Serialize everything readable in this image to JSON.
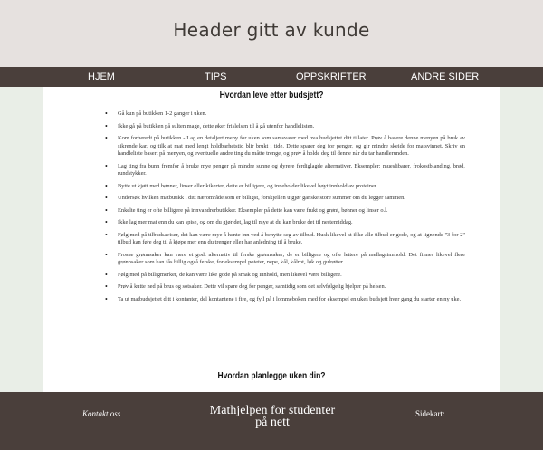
{
  "header": {
    "title": "Header gitt av kunde"
  },
  "nav": {
    "items": [
      "HJEM",
      "TIPS",
      "OPPSKRIFTER",
      "ANDRE SIDER"
    ]
  },
  "document": {
    "title": "Hvordan leve etter budsjett?",
    "subtitle": "Hvordan planlegge uken din?",
    "tips": [
      "Gå kun på butikken 1-2 ganger i uken.",
      "Ikke gå på butikken på sulten mage, dette øker frislelsen til å gå utenfor handlelisten.",
      "Kom forberedt på butikken - Lag en detaljert meny for uken som samsvarer med hva budsjettet ditt tillater. Prøv å basere denne menyen på bruk av sikrende kar, og tilk at mat med lengt holdbarhetstid blir brukt i tide. Dette sparer deg for penger, og gir mindre skeide for matsvinnet. Skriv en handleliste basert på menyen, og eventuelle andre ting du måtte trenge, og prøv å holde deg til denne når du tar handlerunden.",
      "Lag ting fra bunn fremfor å bruke mye penger på mindre sunne og dyrere ferdiglagde alternativer. Eksempler: mueslibarer, frokostblanding, brød, rundstykker.",
      "Bytte ut kjøtt med bønner, linser eller kikerter, dette er billigere, og inneholder likevel høyt innhold av proteiner.",
      "Undersøk hvilken matbutikk i ditt nærområde som er billigst, forskjellen utgjør ganske store summer om du legger sammen.",
      "Enkelte ting er ofte billigere på innvandrerbutikker. Eksempler på dette kan være frukt og grønt, bønner og linser o.l.",
      "Ikke lag mer mat enn du kan spise, og om du gjør det, lag til mye at du kan bruke det til nestemiddag.",
      "Følg med på tilbudsaviser, det kan være mye å hente inn ved å benytte seg av tilbud. Husk likevel at ikke alle tilbud er gode, og at lignende \"3 for 2\" tilbud kan føre deg til å kjøpe mer enn du trenger eller har anledning til å bruke.",
      "Frosne grønnsaker kan være et godt alternativ til ferske grønnsaker; de er billigere og ofte lettere på mellagsinnhold. Det finnes likevel flere grønnsaker som kan fås billig også ferske, for eksempel poteter, nepe, kål, kålrot, løk og gulrøtter.",
      "Følg med på billigmerker, de kan være like gode på smak og innhold, men likevel være billigere.",
      "Prøv å kutte ned på brus og sotsaker. Dette vil spare deg for penger, samtidig som det selvfølgelig hjelper på helsen.",
      "Ta ut matbudsjettet ditt i kontanter, del kontantene i fire, og fyll på i lommeboken med for eksempel en ukes budsjett hver gang du starter en ny uke."
    ]
  },
  "footer": {
    "contact": "Kontakt oss",
    "center_line1": "Mathjelpen for studenter",
    "center_line2": "på nett",
    "sitemap": "Sidekart:"
  }
}
